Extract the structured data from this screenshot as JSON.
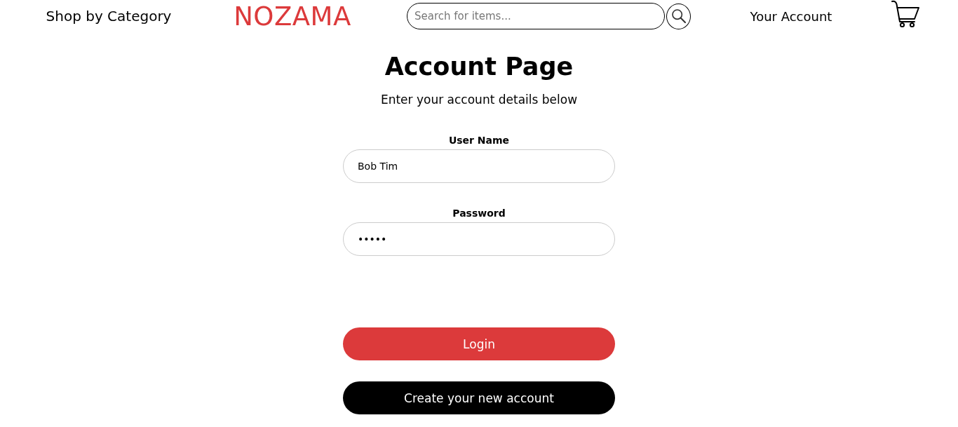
{
  "header": {
    "category_link": "Shop by Category",
    "logo": "NOZAMA",
    "search": {
      "placeholder": "Search for items..."
    },
    "account_link": "Your Account"
  },
  "page": {
    "title": "Account Page",
    "subtitle": "Enter your account details below"
  },
  "form": {
    "fields": [
      {
        "label": "User Name",
        "value": "Bob Tim"
      },
      {
        "label": "Password",
        "value": "•••••"
      }
    ]
  },
  "buttons": [
    {
      "label": "Login",
      "kind": "primary"
    },
    {
      "label": "Create your new account",
      "kind": "secondary"
    }
  ]
}
